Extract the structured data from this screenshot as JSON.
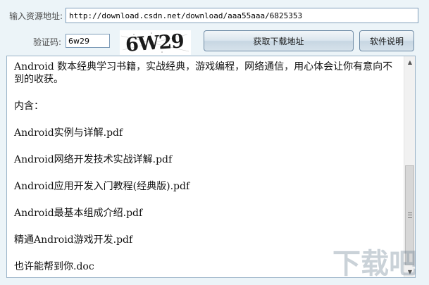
{
  "form": {
    "url_label": "输入资源地址:",
    "url_value": "http://download.csdn.net/download/aaa55aaa/6825353",
    "code_label": "验证码:",
    "code_value": "6w29",
    "captcha_text": "6W29"
  },
  "buttons": {
    "get_download": "获取下载地址",
    "software_help": "软件说明"
  },
  "content": {
    "lines": [
      "Android 数本经典学习书籍，实战经典，游戏编程，网络通信，用心体会让你有意向不到的收获。",
      "内含：",
      "Android实例与详解.pdf",
      "Android网络开发技术实战详解.pdf",
      "Android应用开发入门教程(经典版).pdf",
      "Android最基本组成介绍.pdf",
      "精通Android游戏开发.pdf",
      "也许能帮到你.doc"
    ]
  },
  "watermark": {
    "text": "下载吧"
  }
}
